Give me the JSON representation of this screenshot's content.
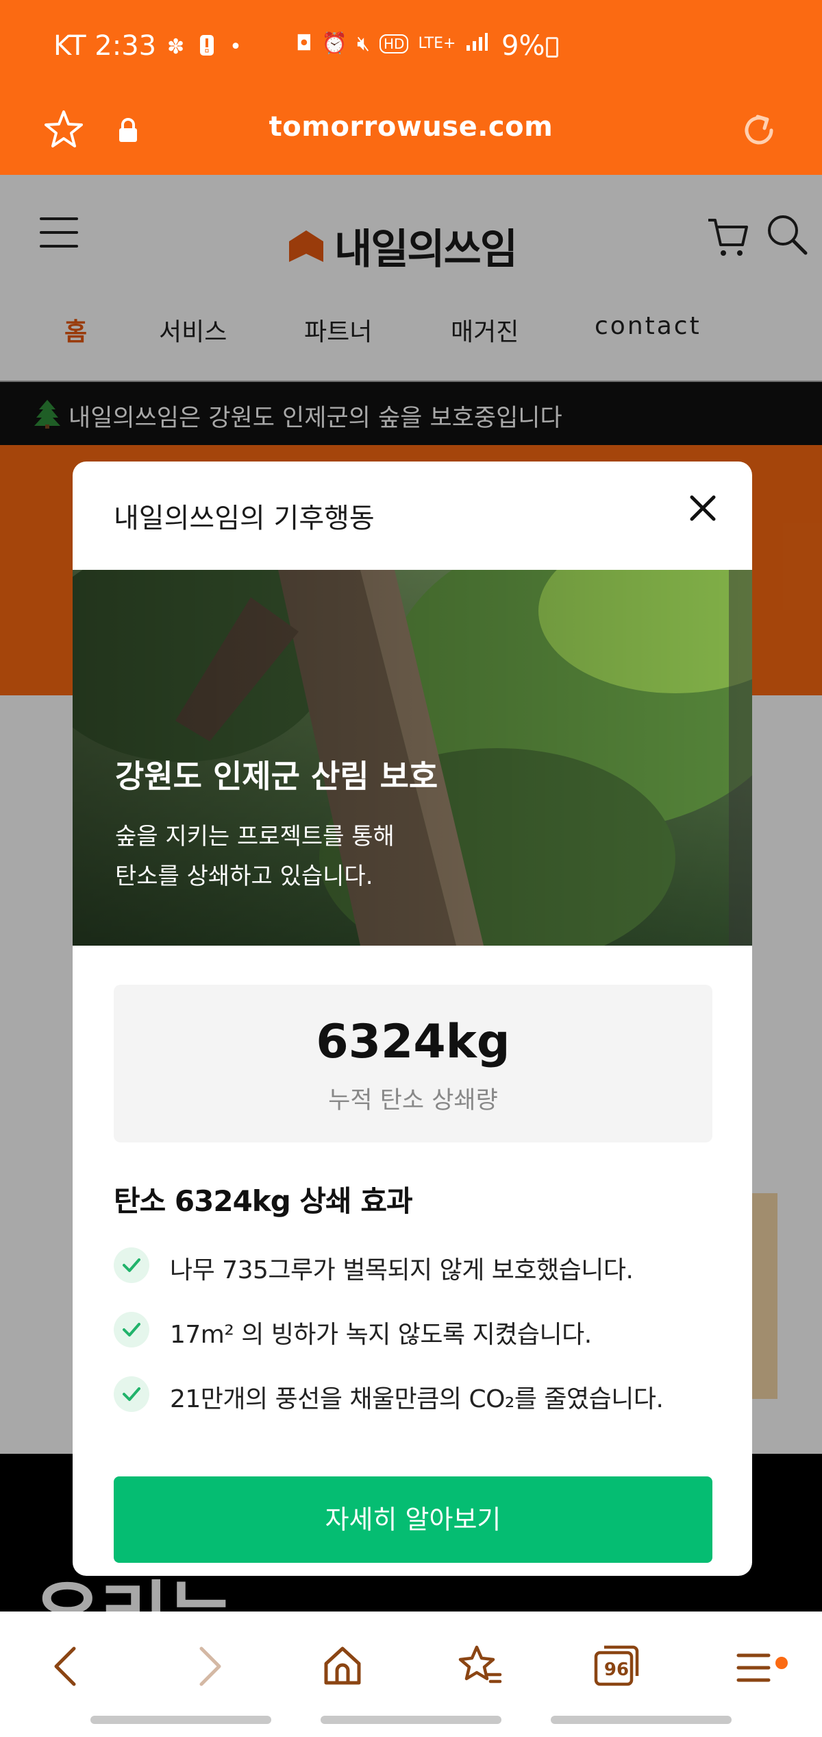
{
  "status_bar": {
    "carrier_time": "KT 2:33",
    "battery": "9%",
    "network": "LTE+",
    "left_icons": [
      "slack-icon",
      "alert-icon",
      "dot-icon"
    ],
    "right_icons": [
      "camera-icon",
      "alarm-icon",
      "mute-icon",
      "hd-icon",
      "lte-icon",
      "signal-icon"
    ]
  },
  "browser": {
    "url": "tomorrowuse.com",
    "toolbar_icons": [
      "back-icon",
      "forward-icon",
      "home-icon",
      "bookmarks-icon",
      "tabs-icon",
      "menu-icon"
    ],
    "tabs_count": "96"
  },
  "site": {
    "logo_text": "내일의쓰임",
    "nav": [
      "홈",
      "서비스",
      "파트너",
      "매거진",
      "contact"
    ],
    "active_nav": "홈",
    "notice": "내일의쓰임은 강원도 인제군의 숲을 보호중입니다",
    "notice_icon": "tree-icon",
    "background_heading_fragment": "우리는"
  },
  "modal": {
    "title": "내일의쓰임의 기후행동",
    "photo_title": "강원도 인제군 산림 보호",
    "photo_desc_line1": "숲을 지키는 프로젝트를 통해",
    "photo_desc_line2": "탄소를 상쇄하고 있습니다.",
    "stat_value": "6324kg",
    "stat_label": "누적 탄소 상쇄량",
    "effects_title": "탄소 6324kg 상쇄 효과",
    "effects": [
      "나무 735그루가 벌목되지 않게 보호했습니다.",
      "17m² 의 빙하가 녹지 않도록 지켰습니다.",
      "21만개의 풍선을 채울만큼의 CO₂를 줄였습니다."
    ],
    "cta": "자세히 알아보기"
  },
  "colors": {
    "brand_orange": "#fb6a12",
    "cta_green": "#05bd72",
    "check_bg": "#e5f6ec",
    "check_mark": "#21b36b"
  }
}
